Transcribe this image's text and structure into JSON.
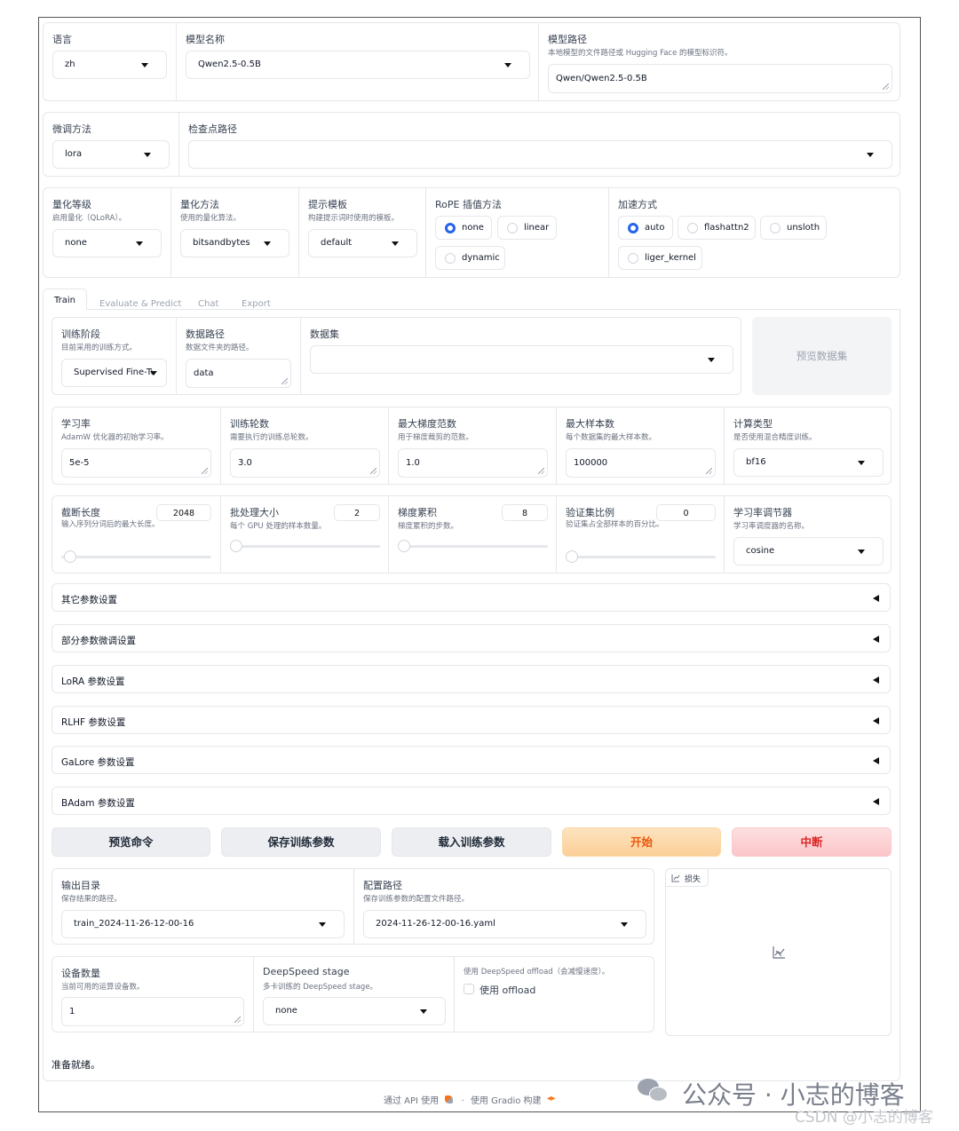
{
  "colors": {
    "accent": "#2563eb",
    "start_button": "#fcd9a8",
    "stop_button": "#fbc9cc",
    "stop_text": "#dc2626",
    "start_text": "#ea580c"
  },
  "top": {
    "lang": {
      "label": "语言",
      "value": "zh"
    },
    "model_name": {
      "label": "模型名称",
      "value": "Qwen2.5-0.5B"
    },
    "model_path": {
      "label": "模型路径",
      "info": "本地模型的文件路径或 Hugging Face 的模型标识符。",
      "value": "Qwen/Qwen2.5-0.5B"
    },
    "finetune": {
      "label": "微调方法",
      "value": "lora"
    },
    "checkpoint": {
      "label": "检查点路径",
      "value": ""
    },
    "quant_bit": {
      "label": "量化等级",
      "info": "启用量化（QLoRA）。",
      "value": "none"
    },
    "quant_method": {
      "label": "量化方法",
      "info": "使用的量化算法。",
      "value": "bitsandbytes"
    },
    "template": {
      "label": "提示模板",
      "info": "构建提示词时使用的模板。",
      "value": "default"
    },
    "rope": {
      "label": "RoPE 插值方法",
      "options": [
        "none",
        "linear",
        "dynamic"
      ]
    },
    "booster": {
      "label": "加速方式",
      "options": [
        "auto",
        "flashattn2",
        "unsloth",
        "liger_kernel"
      ]
    }
  },
  "tabs": [
    "Train",
    "Evaluate & Predict",
    "Chat",
    "Export"
  ],
  "train": {
    "stage": {
      "label": "训练阶段",
      "info": "目前采用的训练方式。",
      "value": "Supervised Fine-Tur"
    },
    "dataset_dir": {
      "label": "数据路径",
      "info": "数据文件夹的路径。",
      "value": "data"
    },
    "dataset": {
      "label": "数据集",
      "value": ""
    },
    "preview_dataset": "预览数据集",
    "lr": {
      "label": "学习率",
      "info": "AdamW 优化器的初始学习率。",
      "value": "5e-5"
    },
    "epochs": {
      "label": "训练轮数",
      "info": "需要执行的训练总轮数。",
      "value": "3.0"
    },
    "max_grad_norm": {
      "label": "最大梯度范数",
      "info": "用于梯度裁剪的范数。",
      "value": "1.0"
    },
    "max_samples": {
      "label": "最大样本数",
      "info": "每个数据集的最大样本数。",
      "value": "100000"
    },
    "compute_type": {
      "label": "计算类型",
      "info": "是否使用混合精度训练。",
      "value": "bf16"
    },
    "cutoff_len": {
      "label": "截断长度",
      "info": "输入序列分词后的最大长度。",
      "value": "2048",
      "fraction": 0.02
    },
    "batch_size": {
      "label": "批处理大小",
      "info": "每个 GPU 处理的样本数量。",
      "value": "2",
      "fraction": 0.0
    },
    "grad_accum": {
      "label": "梯度累积",
      "info": "梯度累积的步数。",
      "value": "8",
      "fraction": 0.0
    },
    "val_size": {
      "label": "验证集比例",
      "info": "验证集占全部样本的百分比。",
      "value": "0",
      "fraction": 0.0
    },
    "lr_scheduler": {
      "label": "学习率调节器",
      "info": "学习率调度器的名称。",
      "value": "cosine"
    },
    "accordions": [
      "其它参数设置",
      "部分参数微调设置",
      "LoRA 参数设置",
      "RLHF 参数设置",
      "GaLore 参数设置",
      "BAdam 参数设置"
    ],
    "buttons": {
      "preview_cmd": "预览命令",
      "save_args": "保存训练参数",
      "load_args": "载入训练参数",
      "start": "开始",
      "stop": "中断"
    },
    "output_dir": {
      "label": "输出目录",
      "info": "保存结果的路径。",
      "value": "train_2024-11-26-12-00-16"
    },
    "config_path": {
      "label": "配置路径",
      "info": "保存训练参数的配置文件路径。",
      "value": "2024-11-26-12-00-16.yaml"
    },
    "device_count": {
      "label": "设备数量",
      "info": "当前可用的运算设备数。",
      "value": "1"
    },
    "ds_stage": {
      "label": "DeepSpeed stage",
      "info": "多卡训练的 DeepSpeed stage。",
      "value": "none"
    },
    "ds_offload": {
      "info": "使用 DeepSpeed offload（会减慢速度）。",
      "label": "使用 offload"
    },
    "loss_label": "损失",
    "status": "准备就绪。"
  },
  "footer": {
    "api": "通过 API 使用",
    "sep": "·",
    "built": "使用 Gradio 构建"
  },
  "watermark": {
    "wechat": "公众号 · 小志的博客",
    "csdn": "CSDN @小志的博客"
  }
}
